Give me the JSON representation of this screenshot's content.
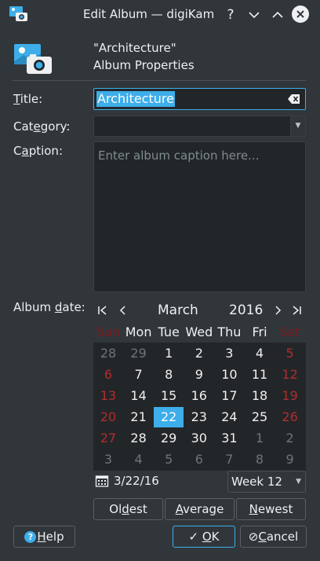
{
  "window": {
    "title": "Edit Album — digiKam"
  },
  "header": {
    "title": "\"Architecture\"",
    "subtitle": "Album Properties"
  },
  "form": {
    "title_label_pre": "",
    "title_label_ul": "T",
    "title_label_post": "itle:",
    "title_value": "Architecture",
    "category_label_pre": "Cat",
    "category_label_ul": "e",
    "category_label_post": "gory:",
    "category_value": "",
    "caption_label_pre": "C",
    "caption_label_ul": "a",
    "caption_label_post": "ption:",
    "caption_placeholder": "Enter album caption here...",
    "date_label_pre": "Album ",
    "date_label_ul": "d",
    "date_label_post": "ate:"
  },
  "calendar": {
    "month": "March",
    "year": "2016",
    "weekday_headers": [
      "Sun",
      "Mon",
      "Tue",
      "Wed",
      "Thu",
      "Fri",
      "Sat"
    ],
    "weeks": [
      [
        "28",
        "29",
        "1",
        "2",
        "3",
        "4",
        "5"
      ],
      [
        "6",
        "7",
        "8",
        "9",
        "10",
        "11",
        "12"
      ],
      [
        "13",
        "14",
        "15",
        "16",
        "17",
        "18",
        "19"
      ],
      [
        "20",
        "21",
        "22",
        "23",
        "24",
        "25",
        "26"
      ],
      [
        "27",
        "28",
        "29",
        "30",
        "31",
        "1",
        "2"
      ],
      [
        "3",
        "4",
        "5",
        "6",
        "7",
        "8",
        "9"
      ]
    ],
    "selected_day": "22",
    "date_value": "3/22/16",
    "week_value": "Week 12"
  },
  "buttons": {
    "oldest_pre": "Ol",
    "oldest_ul": "d",
    "oldest_post": "est",
    "average_pre": "",
    "average_ul": "A",
    "average_post": "verage",
    "newest_pre": "",
    "newest_ul": "N",
    "newest_post": "ewest",
    "help_pre": "",
    "help_ul": "H",
    "help_post": "elp",
    "ok_pre": "",
    "ok_ul": "O",
    "ok_post": "K",
    "cancel_pre": "",
    "cancel_ul": "C",
    "cancel_post": "ancel"
  },
  "colors": {
    "accent": "#3daee9",
    "background": "#31363b",
    "field": "#232629",
    "weekend": "#b22c2c"
  }
}
